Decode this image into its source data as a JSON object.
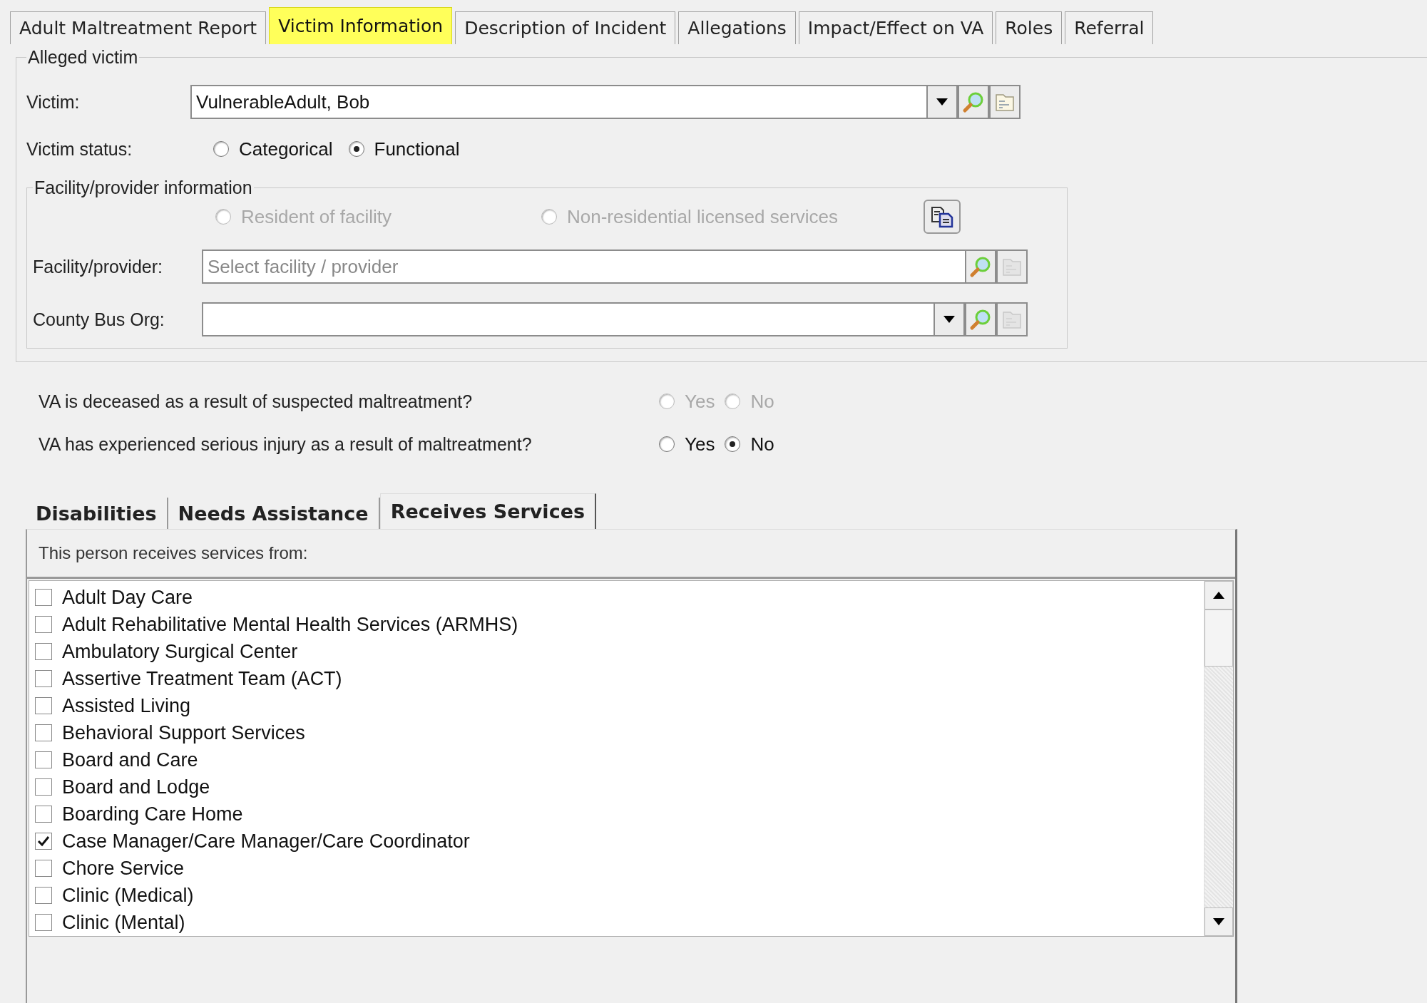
{
  "tabs": [
    {
      "label": "Adult Maltreatment Report",
      "selected": false,
      "highlighted": false
    },
    {
      "label": "Victim Information",
      "selected": true,
      "highlighted": true
    },
    {
      "label": "Description of Incident",
      "selected": false,
      "highlighted": false
    },
    {
      "label": "Allegations",
      "selected": false,
      "highlighted": false
    },
    {
      "label": "Impact/Effect on VA",
      "selected": false,
      "highlighted": false
    },
    {
      "label": "Roles",
      "selected": false,
      "highlighted": false
    },
    {
      "label": "Referral",
      "selected": false,
      "highlighted": false
    }
  ],
  "alleged_victim": {
    "legend": "Alleged victim",
    "victim": {
      "label": "Victim:",
      "value": "VulnerableAdult, Bob"
    },
    "victim_status": {
      "label": "Victim status:",
      "options": [
        {
          "label": "Categorical",
          "selected": false
        },
        {
          "label": "Functional",
          "selected": true
        }
      ]
    },
    "facility": {
      "legend": "Facility/provider information",
      "options": [
        {
          "label": "Resident of facility",
          "selected": false,
          "disabled": true
        },
        {
          "label": "Non-residential licensed services",
          "selected": false,
          "disabled": true
        }
      ],
      "facility_provider": {
        "label": "Facility/provider:",
        "placeholder": "Select facility / provider",
        "dropdown": false
      },
      "county_bus_org": {
        "label": "County Bus Org:",
        "dropdown": true
      }
    }
  },
  "questions": [
    {
      "label": "VA is deceased as a result of suspected maltreatment?",
      "disabled": true,
      "options": [
        {
          "label": "Yes",
          "selected": false
        },
        {
          "label": "No",
          "selected": false
        }
      ]
    },
    {
      "label": "VA has experienced serious injury as a result of maltreatment?",
      "disabled": false,
      "options": [
        {
          "label": "Yes",
          "selected": false
        },
        {
          "label": "No",
          "selected": true
        }
      ]
    }
  ],
  "sub_tabs": [
    {
      "label": "Disabilities",
      "selected": false
    },
    {
      "label": "Needs Assistance",
      "selected": false
    },
    {
      "label": "Receives Services",
      "selected": true
    }
  ],
  "services": {
    "header": "This person receives services from:",
    "items": [
      {
        "label": "Adult Day Care",
        "checked": false
      },
      {
        "label": "Adult Rehabilitative Mental Health Services (ARMHS)",
        "checked": false
      },
      {
        "label": "Ambulatory Surgical Center",
        "checked": false
      },
      {
        "label": "Assertive Treatment Team (ACT)",
        "checked": false
      },
      {
        "label": "Assisted Living",
        "checked": false
      },
      {
        "label": "Behavioral Support Services",
        "checked": false
      },
      {
        "label": "Board and Care",
        "checked": false
      },
      {
        "label": "Board and Lodge",
        "checked": false
      },
      {
        "label": "Boarding Care Home",
        "checked": false
      },
      {
        "label": "Case Manager/Care Manager/Care Coordinator",
        "checked": true
      },
      {
        "label": "Chore Service",
        "checked": false
      },
      {
        "label": "Clinic (Medical)",
        "checked": false
      },
      {
        "label": "Clinic (Mental)",
        "checked": false
      }
    ]
  }
}
